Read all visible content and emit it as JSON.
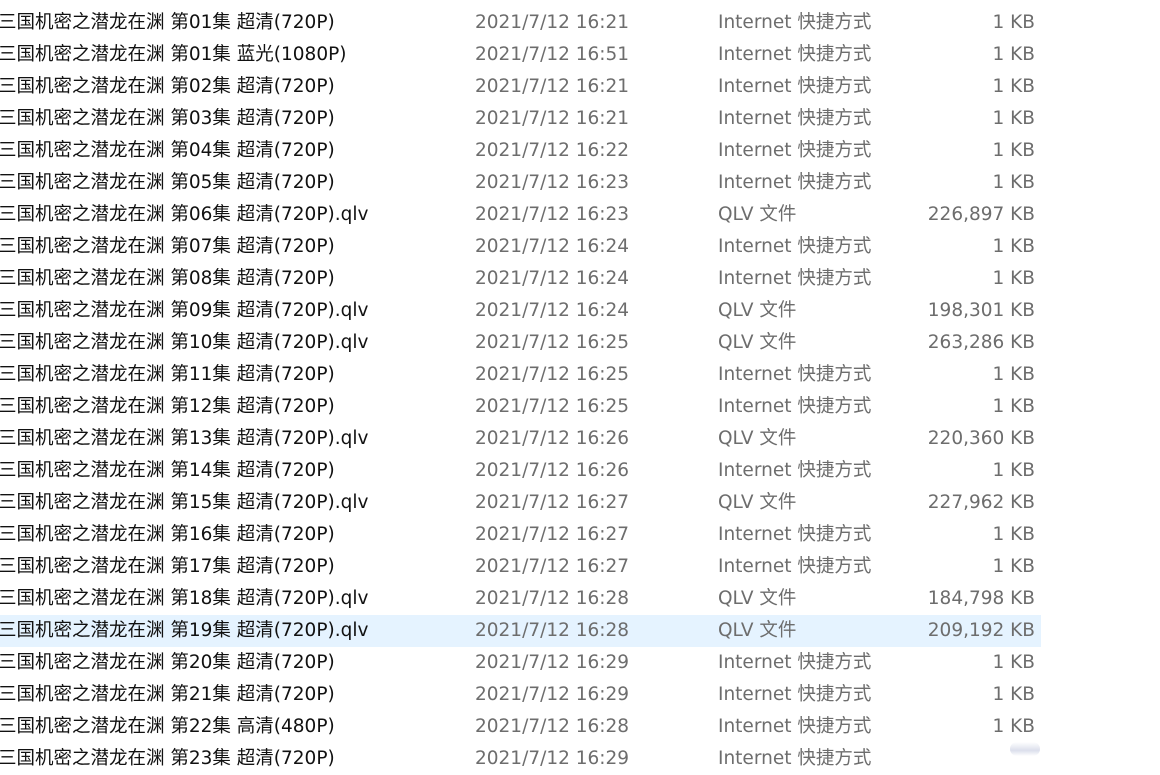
{
  "file_list": {
    "selected_index": 19,
    "rows": [
      {
        "name": "三国机密之潜龙在渊 第01集 超清(720P)",
        "date": "2021/7/12 16:21",
        "type": "Internet 快捷方式",
        "size": "1 KB"
      },
      {
        "name": "三国机密之潜龙在渊 第01集 蓝光(1080P)",
        "date": "2021/7/12 16:51",
        "type": "Internet 快捷方式",
        "size": "1 KB"
      },
      {
        "name": "三国机密之潜龙在渊 第02集 超清(720P)",
        "date": "2021/7/12 16:21",
        "type": "Internet 快捷方式",
        "size": "1 KB"
      },
      {
        "name": "三国机密之潜龙在渊 第03集 超清(720P)",
        "date": "2021/7/12 16:21",
        "type": "Internet 快捷方式",
        "size": "1 KB"
      },
      {
        "name": "三国机密之潜龙在渊 第04集 超清(720P)",
        "date": "2021/7/12 16:22",
        "type": "Internet 快捷方式",
        "size": "1 KB"
      },
      {
        "name": "三国机密之潜龙在渊 第05集 超清(720P)",
        "date": "2021/7/12 16:23",
        "type": "Internet 快捷方式",
        "size": "1 KB"
      },
      {
        "name": "三国机密之潜龙在渊 第06集 超清(720P).qlv",
        "date": "2021/7/12 16:23",
        "type": "QLV 文件",
        "size": "226,897 KB"
      },
      {
        "name": "三国机密之潜龙在渊 第07集 超清(720P)",
        "date": "2021/7/12 16:24",
        "type": "Internet 快捷方式",
        "size": "1 KB"
      },
      {
        "name": "三国机密之潜龙在渊 第08集 超清(720P)",
        "date": "2021/7/12 16:24",
        "type": "Internet 快捷方式",
        "size": "1 KB"
      },
      {
        "name": "三国机密之潜龙在渊 第09集 超清(720P).qlv",
        "date": "2021/7/12 16:24",
        "type": "QLV 文件",
        "size": "198,301 KB"
      },
      {
        "name": "三国机密之潜龙在渊 第10集 超清(720P).qlv",
        "date": "2021/7/12 16:25",
        "type": "QLV 文件",
        "size": "263,286 KB"
      },
      {
        "name": "三国机密之潜龙在渊 第11集 超清(720P)",
        "date": "2021/7/12 16:25",
        "type": "Internet 快捷方式",
        "size": "1 KB"
      },
      {
        "name": "三国机密之潜龙在渊 第12集 超清(720P)",
        "date": "2021/7/12 16:25",
        "type": "Internet 快捷方式",
        "size": "1 KB"
      },
      {
        "name": "三国机密之潜龙在渊 第13集 超清(720P).qlv",
        "date": "2021/7/12 16:26",
        "type": "QLV 文件",
        "size": "220,360 KB"
      },
      {
        "name": "三国机密之潜龙在渊 第14集 超清(720P)",
        "date": "2021/7/12 16:26",
        "type": "Internet 快捷方式",
        "size": "1 KB"
      },
      {
        "name": "三国机密之潜龙在渊 第15集 超清(720P).qlv",
        "date": "2021/7/12 16:27",
        "type": "QLV 文件",
        "size": "227,962 KB"
      },
      {
        "name": "三国机密之潜龙在渊 第16集 超清(720P)",
        "date": "2021/7/12 16:27",
        "type": "Internet 快捷方式",
        "size": "1 KB"
      },
      {
        "name": "三国机密之潜龙在渊 第17集 超清(720P)",
        "date": "2021/7/12 16:27",
        "type": "Internet 快捷方式",
        "size": "1 KB"
      },
      {
        "name": "三国机密之潜龙在渊 第18集 超清(720P).qlv",
        "date": "2021/7/12 16:28",
        "type": "QLV 文件",
        "size": "184,798 KB"
      },
      {
        "name": "三国机密之潜龙在渊 第19集 超清(720P).qlv",
        "date": "2021/7/12 16:28",
        "type": "QLV 文件",
        "size": "209,192 KB"
      },
      {
        "name": "三国机密之潜龙在渊 第20集 超清(720P)",
        "date": "2021/7/12 16:29",
        "type": "Internet 快捷方式",
        "size": "1 KB"
      },
      {
        "name": "三国机密之潜龙在渊 第21集 超清(720P)",
        "date": "2021/7/12 16:29",
        "type": "Internet 快捷方式",
        "size": "1 KB"
      },
      {
        "name": "三国机密之潜龙在渊 第22集 高清(480P)",
        "date": "2021/7/12 16:28",
        "type": "Internet 快捷方式",
        "size": "1 KB"
      },
      {
        "name": "三国机密之潜龙在渊 第23集 超清(720P)",
        "date": "2021/7/12 16:29",
        "type": "Internet 快捷方式",
        "size": ""
      }
    ]
  },
  "colors": {
    "selected_row_background": "#e5f3ff",
    "name_text": "#111111",
    "detail_text": "#6d6d6d"
  }
}
